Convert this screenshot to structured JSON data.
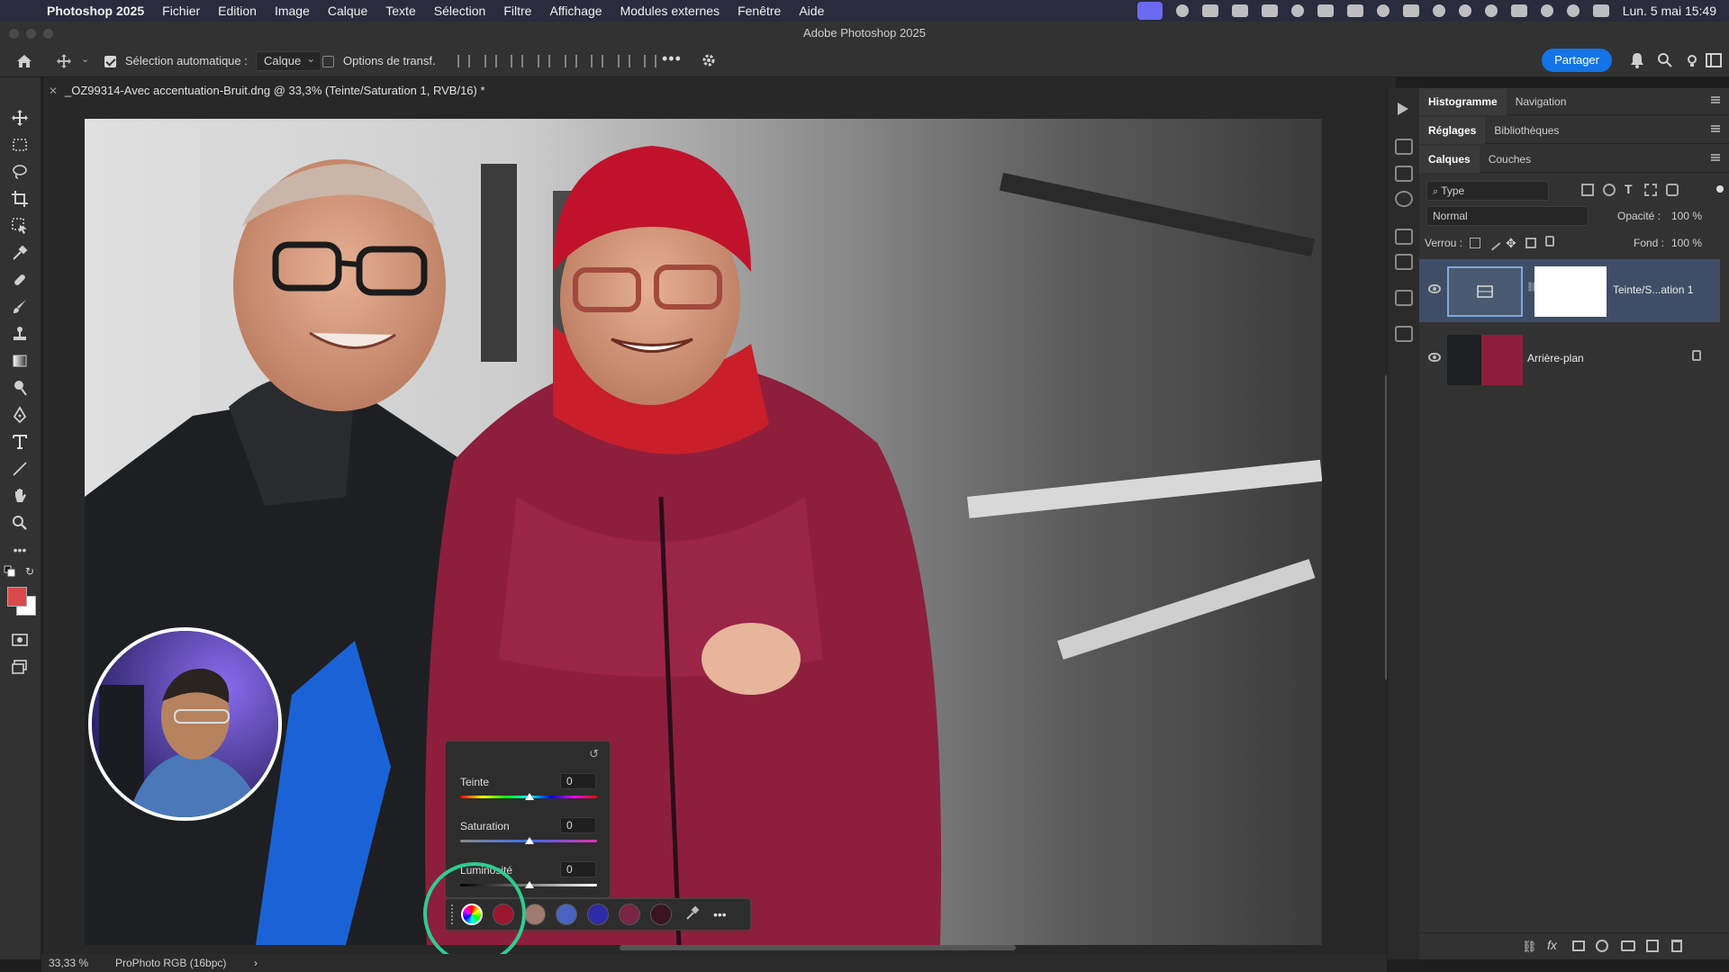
{
  "menubar": {
    "app_name": "Photoshop 2025",
    "items": [
      "Fichier",
      "Edition",
      "Image",
      "Calque",
      "Texte",
      "Sélection",
      "Filtre",
      "Affichage",
      "Modules externes",
      "Fenêtre",
      "Aide"
    ],
    "clock": "Lun. 5 mai  15:49"
  },
  "window": {
    "title": "Adobe Photoshop 2025"
  },
  "options": {
    "auto_select_label": "Sélection automatique :",
    "auto_select_value": "Calque",
    "transform_label": "Options de transf.",
    "share_label": "Partager"
  },
  "document": {
    "tab_title": "_OZ99314-Avec accentuation-Bruit.dng @ 33,3% (Teinte/Saturation 1, RVB/16) *"
  },
  "huesat": {
    "hue_label": "Teinte",
    "hue_value": "0",
    "saturation_label": "Saturation",
    "saturation_value": "0",
    "lightness_label": "Luminosité",
    "lightness_value": "0"
  },
  "swatches": [
    "#9b1530",
    "#a07a70",
    "#4a63c0",
    "#2f2aa8",
    "#7a2545",
    "#3a1420"
  ],
  "panels": {
    "top_tabs": [
      "Histogramme",
      "Navigation"
    ],
    "adj_tabs": [
      "Réglages",
      "Bibliothèques"
    ],
    "layer_tabs": [
      "Calques",
      "Couches"
    ],
    "filter_kind": "Type",
    "blend_mode": "Normal",
    "opacity_label": "Opacité :",
    "opacity_value": "100 %",
    "lock_label": "Verrou :",
    "fill_label": "Fond :",
    "fill_value": "100 %",
    "layers": [
      {
        "name": "Teinte/S...ation 1",
        "selected": true
      },
      {
        "name": "Arrière-plan",
        "selected": false
      }
    ]
  },
  "status": {
    "zoom": "33,33 %",
    "profile": "ProPhoto RGB (16bpc)"
  }
}
